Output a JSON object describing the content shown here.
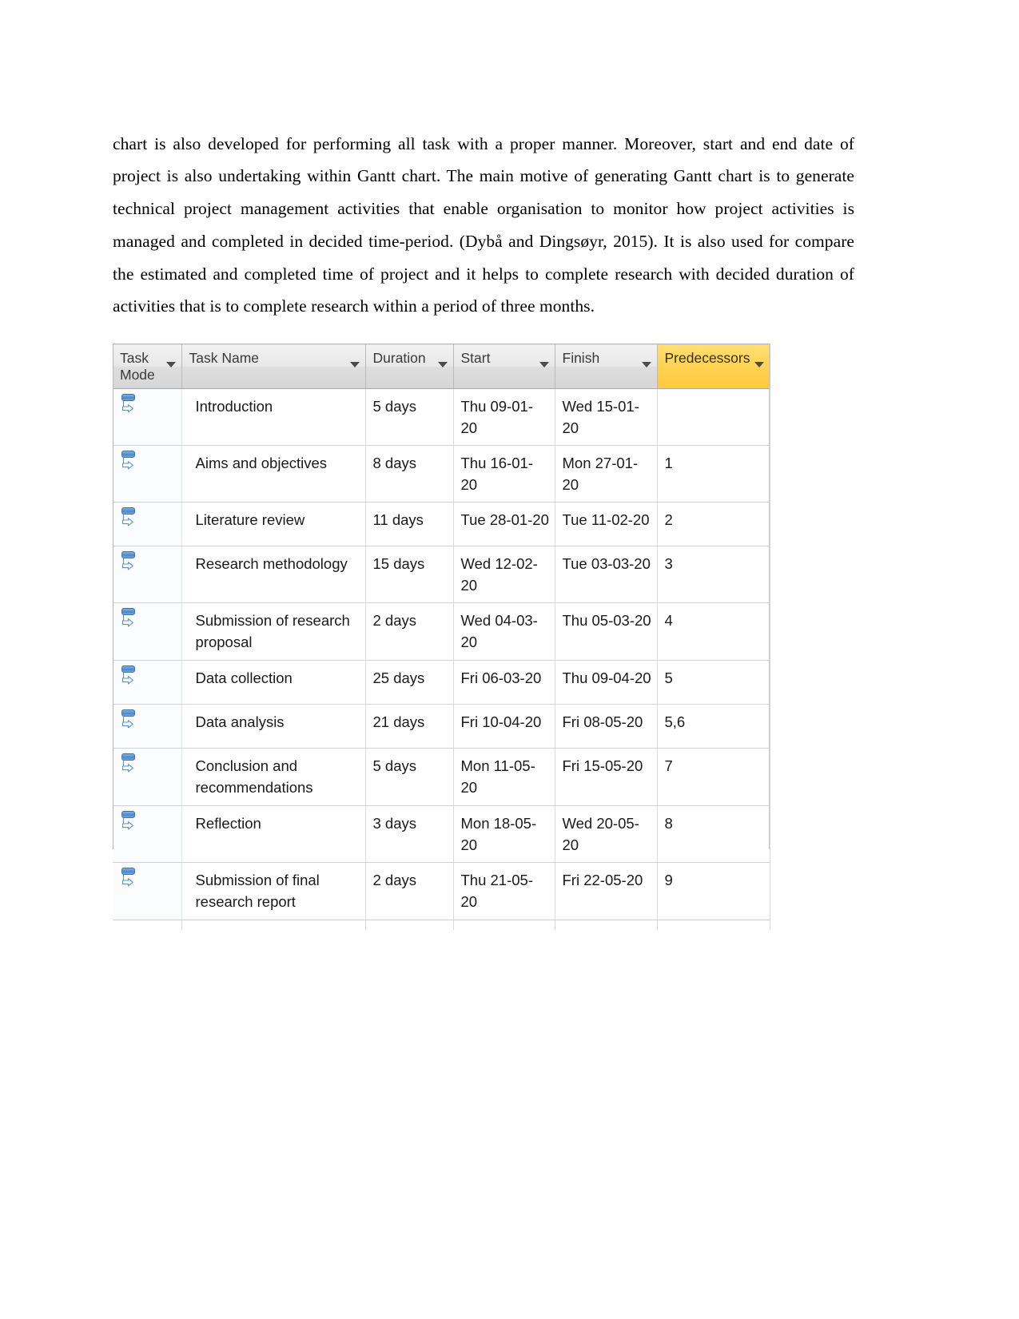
{
  "document": {
    "paragraph": "chart is also developed for performing all task with a proper manner. Moreover, start and end date of project is also undertaking within Gantt chart. The main motive of generating Gantt chart is to generate technical project management activities that enable organisation to monitor how project activities is managed and completed in decided time-period. (Dybå and Dingsøyr, 2015). It is also used for compare the estimated and completed time of project and it helps to complete research with decided duration of activities that is to complete research within a period of three months."
  },
  "gantt_table": {
    "columns": [
      {
        "key": "task_mode",
        "label": "Task Mode",
        "highlighted": false
      },
      {
        "key": "task_name",
        "label": "Task Name",
        "highlighted": false
      },
      {
        "key": "duration",
        "label": "Duration",
        "highlighted": false
      },
      {
        "key": "start",
        "label": "Start",
        "highlighted": false
      },
      {
        "key": "finish",
        "label": "Finish",
        "highlighted": false
      },
      {
        "key": "predecessors",
        "label": "Predecessors",
        "highlighted": true
      }
    ],
    "highlight_color": "#ffd14f",
    "mode_icon": "auto-schedule-icon",
    "rows": [
      {
        "mode": "auto-schedule-icon",
        "name": "Introduction",
        "duration": "5 days",
        "start": "Thu 09-01-20",
        "finish": "Wed 15-01-20",
        "predecessors": ""
      },
      {
        "mode": "auto-schedule-icon",
        "name": "Aims and objectives",
        "duration": "8 days",
        "start": "Thu 16-01-20",
        "finish": "Mon 27-01-20",
        "predecessors": "1"
      },
      {
        "mode": "auto-schedule-icon",
        "name": "Literature review",
        "duration": "11 days",
        "start": "Tue 28-01-20",
        "finish": "Tue 11-02-20",
        "predecessors": "2"
      },
      {
        "mode": "auto-schedule-icon",
        "name": "Research methodology",
        "duration": "15 days",
        "start": "Wed 12-02-20",
        "finish": "Tue 03-03-20",
        "predecessors": "3"
      },
      {
        "mode": "auto-schedule-icon",
        "name": "Submission of research proposal",
        "duration": "2 days",
        "start": "Wed 04-03-20",
        "finish": "Thu 05-03-20",
        "predecessors": "4"
      },
      {
        "mode": "auto-schedule-icon",
        "name": "Data collection",
        "duration": "25 days",
        "start": "Fri 06-03-20",
        "finish": "Thu 09-04-20",
        "predecessors": "5"
      },
      {
        "mode": "auto-schedule-icon",
        "name": "Data analysis",
        "duration": "21 days",
        "start": "Fri 10-04-20",
        "finish": "Fri 08-05-20",
        "predecessors": "5,6"
      },
      {
        "mode": "auto-schedule-icon",
        "name": "Conclusion and recommendations",
        "duration": "5 days",
        "start": "Mon 11-05-20",
        "finish": "Fri 15-05-20",
        "predecessors": "7"
      },
      {
        "mode": "auto-schedule-icon",
        "name": "Reflection",
        "duration": "3 days",
        "start": "Mon 18-05-20",
        "finish": "Wed 20-05-20",
        "predecessors": "8"
      },
      {
        "mode": "auto-schedule-icon",
        "name": "Submission of final research report",
        "duration": "2 days",
        "start": "Thu 21-05-20",
        "finish": "Fri 22-05-20",
        "predecessors": "9"
      }
    ]
  }
}
